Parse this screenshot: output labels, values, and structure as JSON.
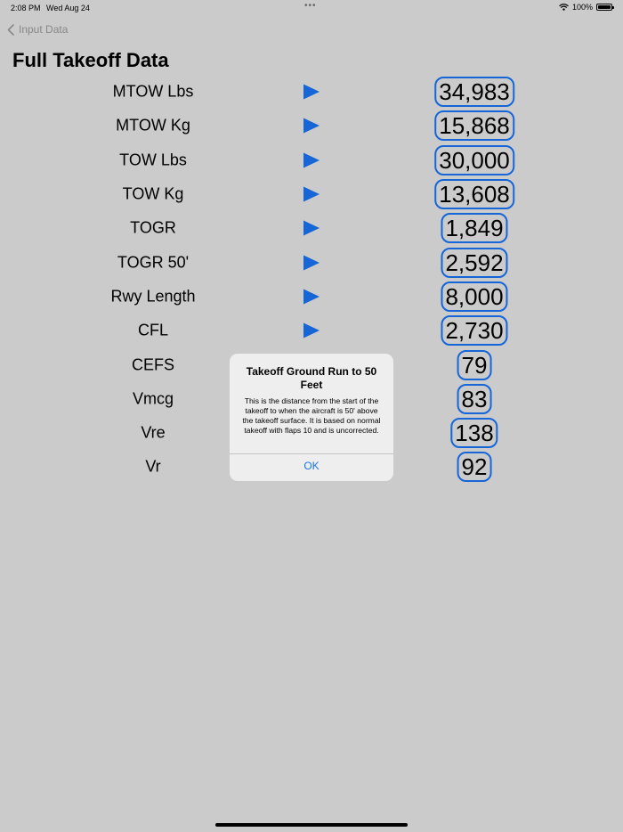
{
  "status_bar": {
    "time": "2:08 PM",
    "date": "Wed Aug 24",
    "dots": "•••",
    "battery": "100%",
    "battery_level": 1.0
  },
  "nav": {
    "back_label": "Input Data"
  },
  "title": "Full Takeoff Data",
  "rows": [
    {
      "label": "MTOW Lbs",
      "value": "34,983",
      "has_info": true
    },
    {
      "label": "MTOW Kg",
      "value": "15,868",
      "has_info": true
    },
    {
      "label": "TOW Lbs",
      "value": "30,000",
      "has_info": true
    },
    {
      "label": "TOW Kg",
      "value": "13,608",
      "has_info": true
    },
    {
      "label": "TOGR",
      "value": "1,849",
      "has_info": true
    },
    {
      "label": "TOGR 50'",
      "value": "2,592",
      "has_info": true
    },
    {
      "label": "Rwy Length",
      "value": "8,000",
      "has_info": true
    },
    {
      "label": "CFL",
      "value": "2,730",
      "has_info": true
    },
    {
      "label": "CEFS",
      "value": "79",
      "has_info": false
    },
    {
      "label": "Vmcg",
      "value": "83",
      "has_info": false
    },
    {
      "label": "Vre",
      "value": "138",
      "has_info": false
    },
    {
      "label": "Vr",
      "value": "92",
      "has_info": false
    }
  ],
  "alert": {
    "title": "Takeoff Ground Run to 50 Feet",
    "message": "This is the distance from the start of the takeoff to when the aircraft is 50' above the takeoff surface. It is based on normal takeoff with flaps 10 and is uncorrected.",
    "ok_label": "OK"
  },
  "colors": {
    "background": "#cbcbcc",
    "accent": "#1666d8",
    "value_border": "#1666d8",
    "alert_button": "#1a73e8"
  }
}
